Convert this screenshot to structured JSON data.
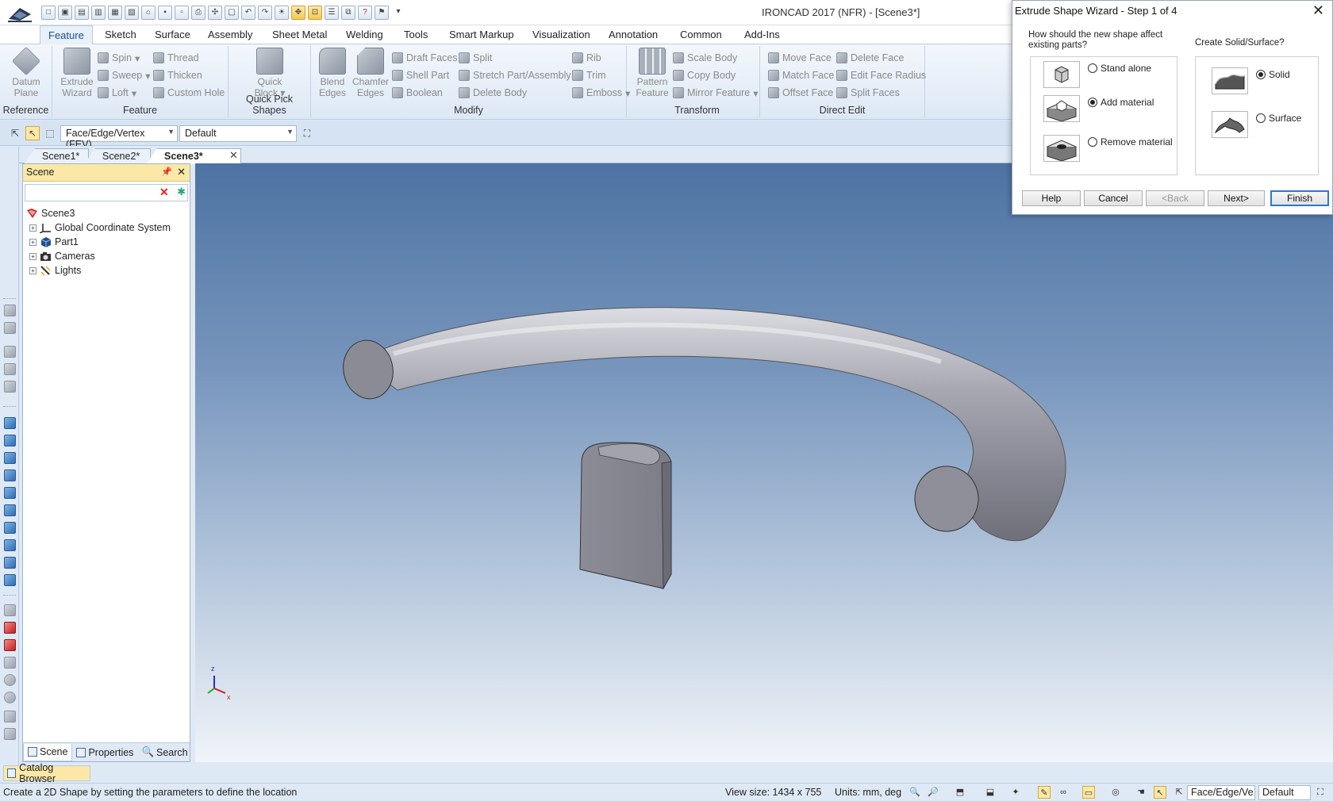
{
  "window": {
    "title": "IRONCAD 2017 (NFR) - [Scene3*]"
  },
  "ribbon_tabs": [
    "Feature",
    "Sketch",
    "Surface",
    "Assembly",
    "Sheet Metal",
    "Welding",
    "Tools",
    "Smart Markup",
    "Visualization",
    "Annotation",
    "Common",
    "Add-Ins"
  ],
  "ribbon": {
    "reference": {
      "label": "Reference",
      "datum_plane": "Datum",
      "datum_plane2": "Plane"
    },
    "feature": {
      "label": "Feature",
      "extrude": "Extrude",
      "extrude2": "Wizard",
      "spin": "Spin",
      "sweep": "Sweep",
      "loft": "Loft",
      "thread": "Thread",
      "thicken": "Thicken",
      "custom_hole": "Custom Hole"
    },
    "quick_pick": {
      "label": "Quick Pick Shapes",
      "quick": "Quick",
      "block": "Block"
    },
    "modify": {
      "label": "Modify",
      "blend": "Blend",
      "blend2": "Edges",
      "chamfer": "Chamfer",
      "chamfer2": "Edges",
      "draft_faces": "Draft Faces",
      "shell_part": "Shell Part",
      "boolean": "Boolean",
      "split": "Split",
      "stretch": "Stretch Part/Assembly",
      "delete_body": "Delete Body",
      "rib": "Rib",
      "trim": "Trim",
      "emboss": "Emboss"
    },
    "transform": {
      "label": "Transform",
      "pattern": "Pattern",
      "pattern2": "Feature",
      "scale_body": "Scale Body",
      "copy_body": "Copy Body",
      "mirror_feature": "Mirror Feature"
    },
    "direct_edit": {
      "label": "Direct Edit",
      "move_face": "Move Face",
      "match_face": "Match Face",
      "offset_face": "Offset Face",
      "delete_face": "Delete Face",
      "edit_face_radius": "Edit Face Radius",
      "split_faces": "Split Faces"
    }
  },
  "selection_toolbar": {
    "filter": "Face/Edge/Vertex (FEV)",
    "config": "Default"
  },
  "doc_tabs": [
    "Scene1*",
    "Scene2*",
    "Scene3*"
  ],
  "scene_panel": {
    "title": "Scene",
    "tree": [
      {
        "label": "Scene3",
        "icon": "scene-icon"
      },
      {
        "label": "Global Coordinate System",
        "icon": "coordinate-system-icon"
      },
      {
        "label": "Part1",
        "icon": "part-icon"
      },
      {
        "label": "Cameras",
        "icon": "camera-icon"
      },
      {
        "label": "Lights",
        "icon": "light-icon"
      }
    ],
    "footer_tabs": [
      "Scene",
      "Properties",
      "Search"
    ]
  },
  "catalog_browser": "Catalog Browser",
  "triad": {
    "z": "z",
    "x": "x"
  },
  "wizard": {
    "title": "Extrude Shape Wizard - Step 1 of 4",
    "question1": "How should the new shape affect existing parts?",
    "question2": "Create Solid/Surface?",
    "options1": [
      {
        "label": "Stand alone",
        "checked": false
      },
      {
        "label": "Add material",
        "checked": true
      },
      {
        "label": "Remove material",
        "checked": false
      }
    ],
    "options2": [
      {
        "label": "Solid",
        "checked": true
      },
      {
        "label": "Surface",
        "checked": false
      }
    ],
    "buttons": {
      "help": "Help",
      "cancel": "Cancel",
      "back": "<Back",
      "next": "Next>",
      "finish": "Finish"
    }
  },
  "status": {
    "message": "Create a 2D Shape by setting the parameters to define the location",
    "view_size": "View size: 1434 x  755",
    "units": "Units: mm, deg",
    "filter": "Face/Edge/Ve",
    "config": "Default"
  }
}
